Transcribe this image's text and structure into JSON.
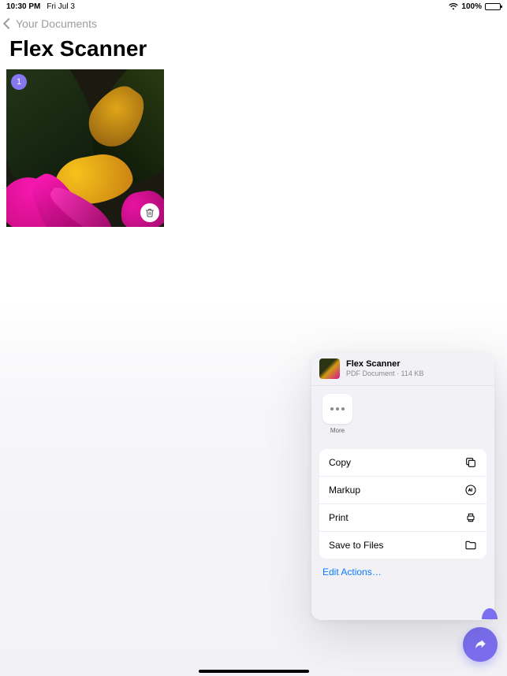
{
  "status": {
    "time": "10:30 PM",
    "date": "Fri Jul 3",
    "battery_pct": "100%"
  },
  "nav": {
    "back_label": "Your Documents"
  },
  "page": {
    "title": "Flex Scanner"
  },
  "document": {
    "page_count": "1"
  },
  "share_sheet": {
    "title": "Flex Scanner",
    "subtitle": "PDF Document · 114 KB",
    "more_label": "More",
    "actions": {
      "copy": "Copy",
      "markup": "Markup",
      "print": "Print",
      "save_to_files": "Save to Files"
    },
    "edit_actions": "Edit Actions…"
  }
}
